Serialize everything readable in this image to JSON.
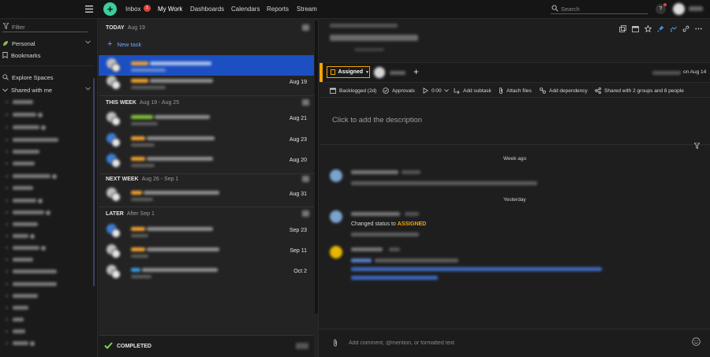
{
  "topbar": {
    "nav": [
      "Inbox",
      "My Work",
      "Dashboards",
      "Calendars",
      "Reports",
      "Stream"
    ],
    "inbox_badge": "1",
    "search_placeholder": "Search",
    "help_label": "?"
  },
  "sidebar": {
    "filter_placeholder": "Filter",
    "personal_label": "Personal",
    "bookmarks_label": "Bookmarks",
    "explore_label": "Explore Spaces",
    "shared_label": "Shared with me"
  },
  "list": {
    "new_task_label": "New task",
    "sections": [
      {
        "title": "TODAY",
        "range": "Aug 19"
      },
      {
        "title": "THIS WEEK",
        "range": "Aug 19 - Aug 25"
      },
      {
        "title": "NEXT WEEK",
        "range": "Aug 26 - Sep 1"
      },
      {
        "title": "LATER",
        "range": "After Sep 1"
      }
    ],
    "dates": [
      "Aug 19",
      "Aug 21",
      "Aug 23",
      "Aug 20",
      "Aug 31",
      "Sep 23",
      "Sep 11",
      "Oct 2"
    ],
    "completed_label": "COMPLETED"
  },
  "task": {
    "status_label": "Assigned",
    "created_on": "on Aug 14",
    "actions": [
      "Backlogged (2d)",
      "Approvals",
      "0:00",
      "Add subtask",
      "Attach files",
      "Add dependency",
      "Shared with 2 groups and 8 people"
    ],
    "description_placeholder": "Click to add the description",
    "week_ago_label": "Week ago",
    "yesterday_label": "Yesterday",
    "changed_status_prefix": "Changed status to",
    "changed_status_value": "ASSIGNED",
    "comment_placeholder": "Add comment, @mention, or formatted text"
  },
  "colors": {
    "accent_green": "#3ccf9e",
    "selected_blue": "#1b4fc2",
    "assigned_orange": "#f0a500",
    "link_blue": "#6fa4ff"
  }
}
